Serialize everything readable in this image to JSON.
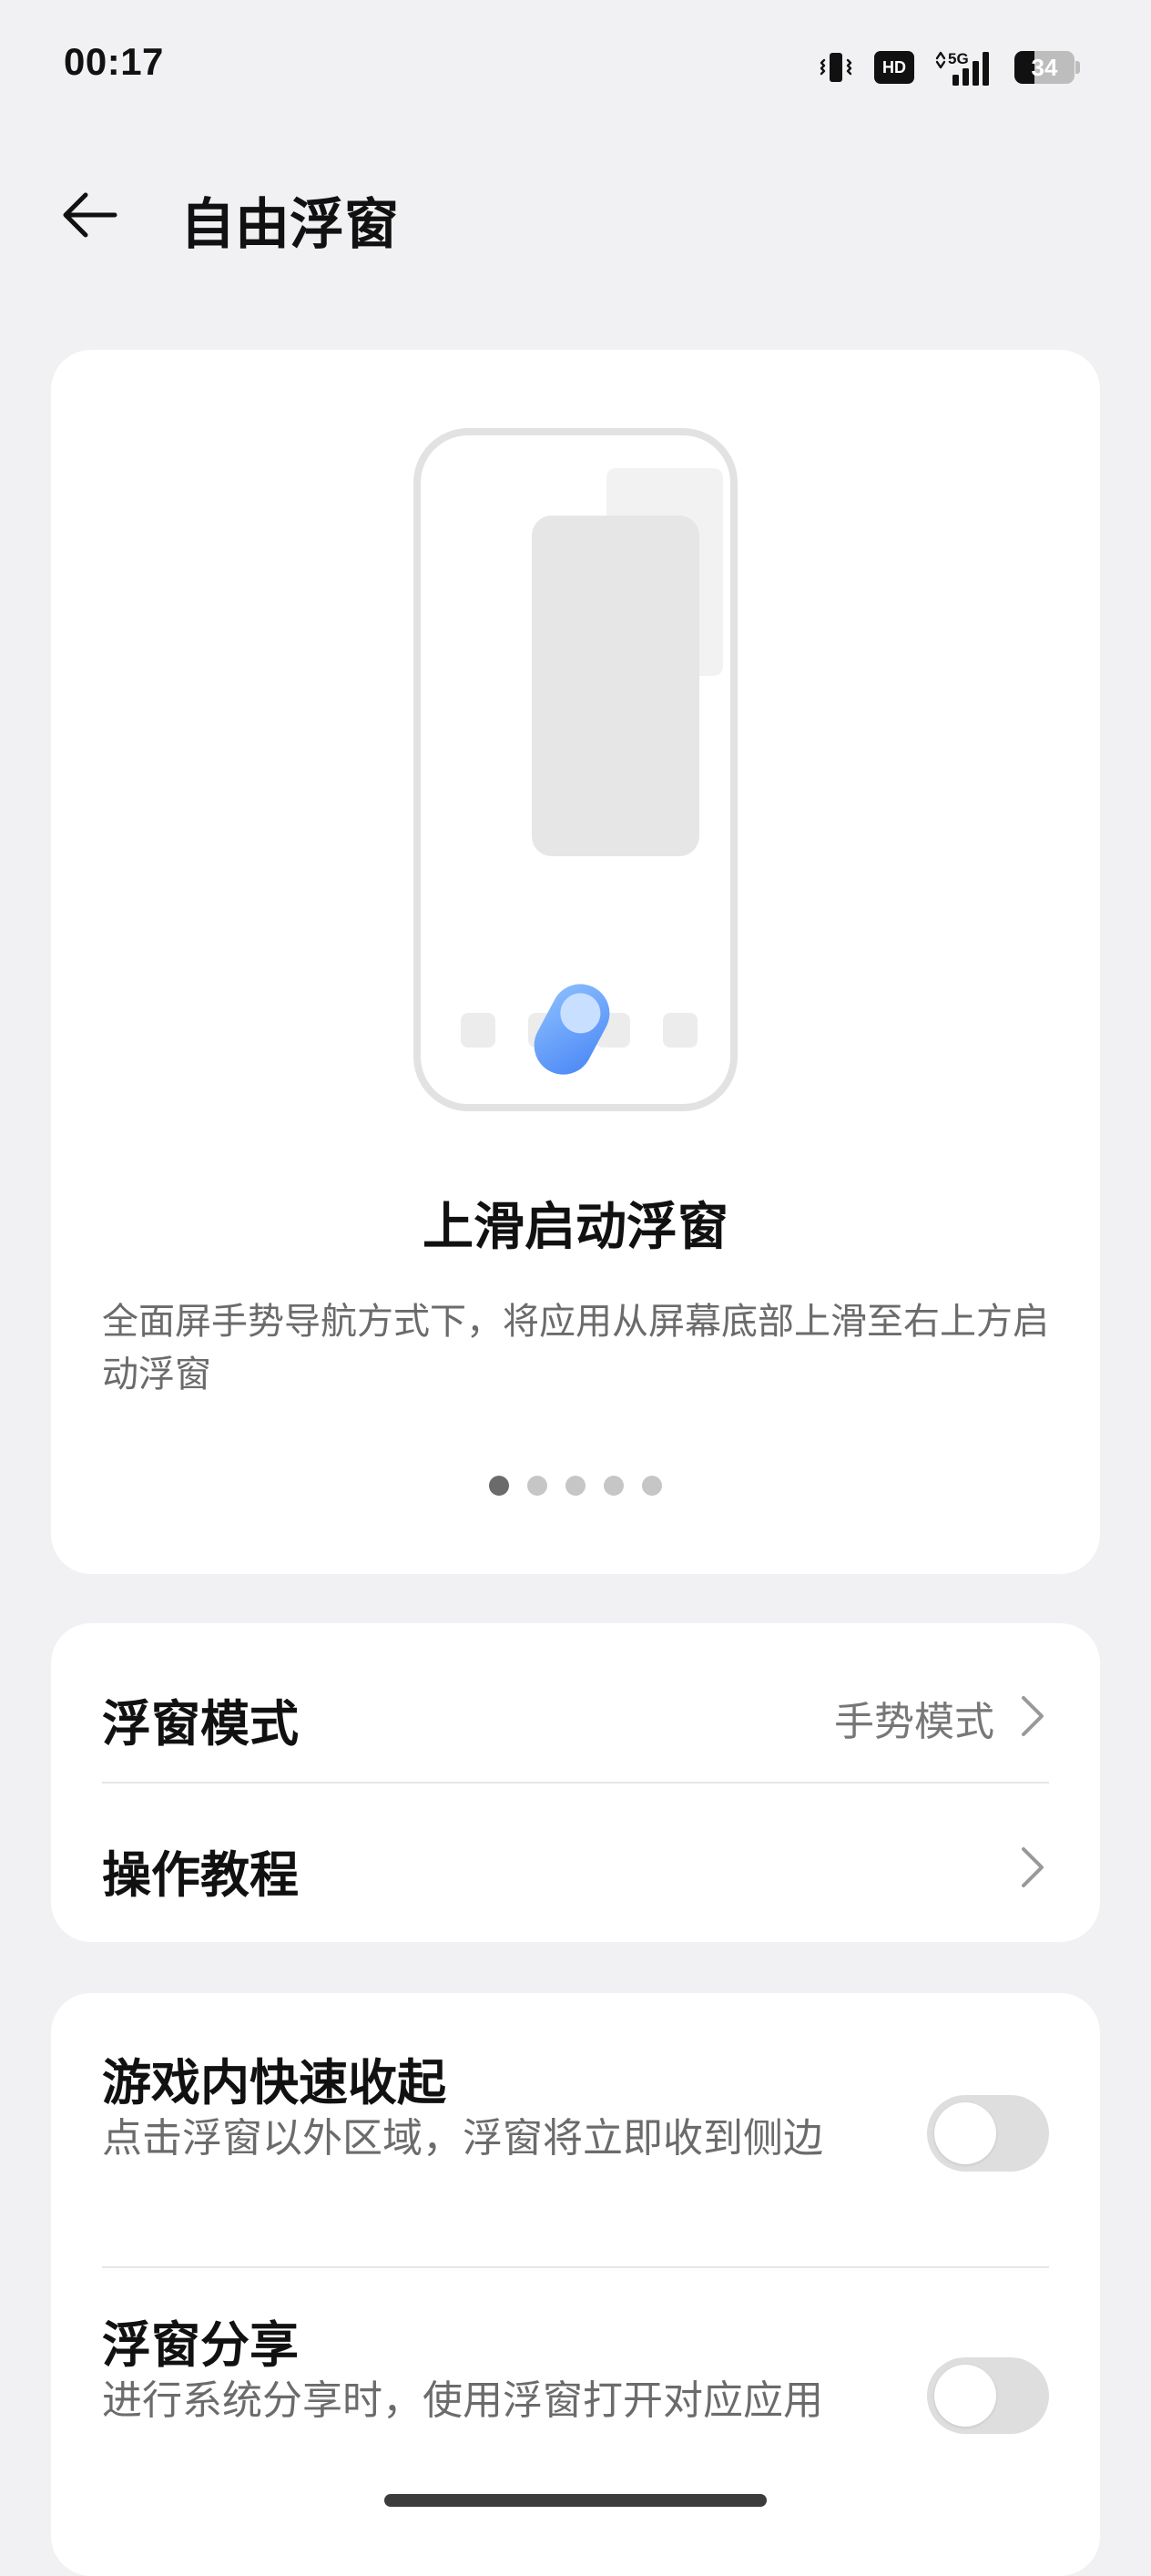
{
  "status_bar": {
    "time": "00:17",
    "hd_label": "HD",
    "network_label": "5G",
    "battery_level": "34",
    "battery_fraction": 0.34,
    "icons": [
      "vibrate-icon",
      "hd-icon",
      "signal-5g-icon",
      "battery-icon"
    ]
  },
  "header": {
    "title": "自由浮窗",
    "back_icon": "back-arrow-icon"
  },
  "hero": {
    "caption_title": "上滑启动浮窗",
    "caption_desc": "全面屏手势导航方式下，将应用从屏幕底部上滑至右上方启动浮窗",
    "page_count": 5,
    "active_page": 1
  },
  "nav": {
    "items": [
      {
        "label": "浮窗模式",
        "value": "手势模式",
        "icon": "chevron-right-icon"
      },
      {
        "label": "操作教程",
        "value": "",
        "icon": "chevron-right-icon"
      }
    ]
  },
  "toggles": {
    "items": [
      {
        "title": "游戏内快速收起",
        "desc": "点击浮窗以外区域，浮窗将立即收到侧边",
        "on": false
      },
      {
        "title": "浮窗分享",
        "desc": "进行系统分享时，使用浮窗打开对应应用",
        "on": false
      }
    ]
  },
  "colors": {
    "background": "#f1f1f3",
    "card": "#ffffff",
    "accent_blue": "#5b9bff",
    "muted_text": "#6b6b6b",
    "switch_off": "#dedede"
  }
}
